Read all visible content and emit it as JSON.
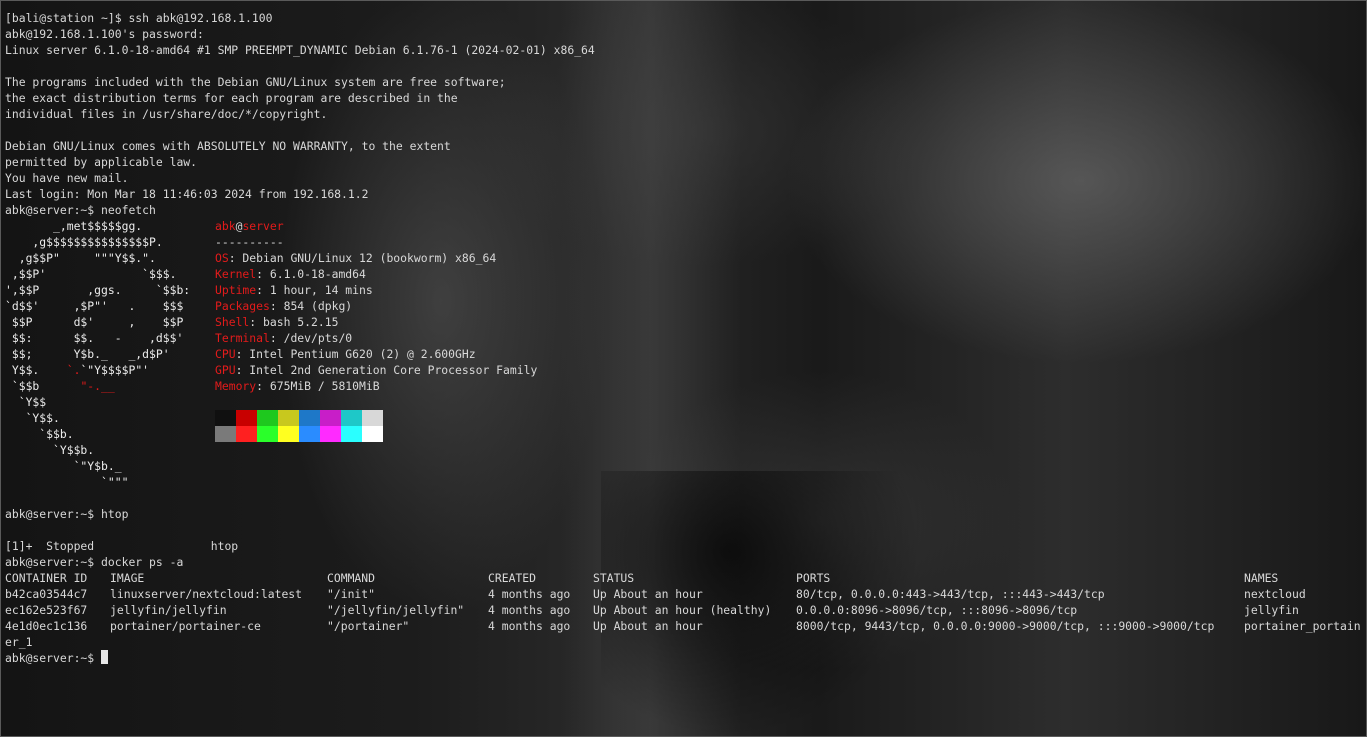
{
  "terminal": {
    "intro": [
      "[bali@station ~]$ ssh abk@192.168.1.100",
      "abk@192.168.1.100's password:",
      "Linux server 6.1.0-18-amd64 #1 SMP PREEMPT_DYNAMIC Debian 6.1.76-1 (2024-02-01) x86_64",
      "",
      "The programs included with the Debian GNU/Linux system are free software;",
      "the exact distribution terms for each program are described in the",
      "individual files in /usr/share/doc/*/copyright.",
      "",
      "Debian GNU/Linux comes with ABSOLUTELY NO WARRANTY, to the extent",
      "permitted by applicable law.",
      "You have new mail.",
      "Last login: Mon Mar 18 11:46:03 2024 from 192.168.1.2",
      "abk@server:~$ neofetch"
    ],
    "neofetch": {
      "logo": [
        "       _,met$$$$$gg.",
        "    ,g$$$$$$$$$$$$$$$P.",
        "  ,g$$P\"     \"\"\"Y$$.\".",
        " ,$$P'              `$$$.",
        "',$$P       ,ggs.     `$$b:",
        "`d$$'     ,$P\"'   .    $$$",
        " $$P      d$'     ,    $$P",
        " $$:      $$.   -    ,d$$'",
        " $$;      Y$b._   _,d$P'",
        " Y$$.    `.`\"Y$$$$P\"'",
        " `$$b      \"-.__",
        "  `Y$$",
        "   `Y$$.",
        "     `$$b.",
        "       `Y$$b.",
        "          `\"Y$b._",
        "              `\"\"\""
      ],
      "user": "abk",
      "at": "@",
      "host": "server",
      "separator": "----------",
      "fields": [
        {
          "key": "OS",
          "value": ": Debian GNU/Linux 12 (bookworm) x86_64"
        },
        {
          "key": "Kernel",
          "value": ": 6.1.0-18-amd64"
        },
        {
          "key": "Uptime",
          "value": ": 1 hour, 14 mins"
        },
        {
          "key": "Packages",
          "value": ": 854 (dpkg)"
        },
        {
          "key": "Shell",
          "value": ": bash 5.2.15"
        },
        {
          "key": "Terminal",
          "value": ": /dev/pts/0"
        },
        {
          "key": "CPU",
          "value": ": Intel Pentium G620 (2) @ 2.600GHz"
        },
        {
          "key": "GPU",
          "value": ": Intel 2nd Generation Core Processor Family"
        },
        {
          "key": "Memory",
          "value": ": 675MiB / 5810MiB"
        }
      ],
      "palette_top": [
        "#101010",
        "#c80000",
        "#1ec81e",
        "#c8c81e",
        "#1e78c8",
        "#c81ec8",
        "#1ec8c8",
        "#d8d8d8"
      ],
      "palette_bottom": [
        "#7a7a7a",
        "#ff2020",
        "#2aff2a",
        "#ffff20",
        "#2a8cff",
        "#ff2aff",
        "#2affff",
        "#ffffff"
      ]
    },
    "after_neofetch": [
      "",
      "abk@server:~$ htop",
      "",
      "[1]+  Stopped                 htop",
      "abk@server:~$ docker ps -a"
    ],
    "docker": {
      "headers": [
        "CONTAINER ID",
        "IMAGE",
        "COMMAND",
        "CREATED",
        "STATUS",
        "PORTS",
        "NAMES"
      ],
      "rows": [
        [
          "b42ca03544c7",
          "linuxserver/nextcloud:latest",
          "\"/init\"",
          "4 months ago",
          "Up About an hour",
          "80/tcp, 0.0.0.0:443->443/tcp, :::443->443/tcp",
          "nextcloud"
        ],
        [
          "ec162e523f67",
          "jellyfin/jellyfin",
          "\"/jellyfin/jellyfin\"",
          "4 months ago",
          "Up About an hour (healthy)",
          "0.0.0.0:8096->8096/tcp, :::8096->8096/tcp",
          "jellyfin"
        ],
        [
          "4e1d0ec1c136",
          "portainer/portainer-ce",
          "\"/portainer\"",
          "4 months ago",
          "Up About an hour",
          "8000/tcp, 9443/tcp, 0.0.0.0:9000->9000/tcp, :::9000->9000/tcp",
          "portainer_portain"
        ]
      ],
      "wrap": "er_1"
    },
    "prompt": "abk@server:~$ "
  }
}
